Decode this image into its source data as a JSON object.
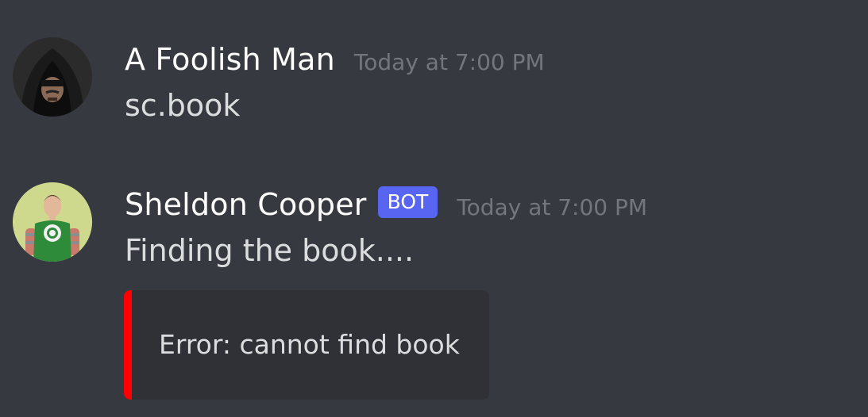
{
  "messages": [
    {
      "author": "A Foolish Man",
      "timestamp": "Today at 7:00 PM",
      "content": "sc.book",
      "avatar_icon": "hooded-figure-avatar"
    },
    {
      "author": "Sheldon Cooper",
      "badge": "BOT",
      "timestamp": "Today at 7:00 PM",
      "content": "Finding the book....",
      "avatar_icon": "green-lantern-shirt-avatar",
      "embed": {
        "text": "Error: cannot find book",
        "color": "#ff0000"
      }
    }
  ],
  "colors": {
    "background": "#36393f",
    "embed_background": "#2f3136",
    "bot_badge": "#5865f2",
    "timestamp": "#72767d",
    "text": "#dcddde"
  }
}
